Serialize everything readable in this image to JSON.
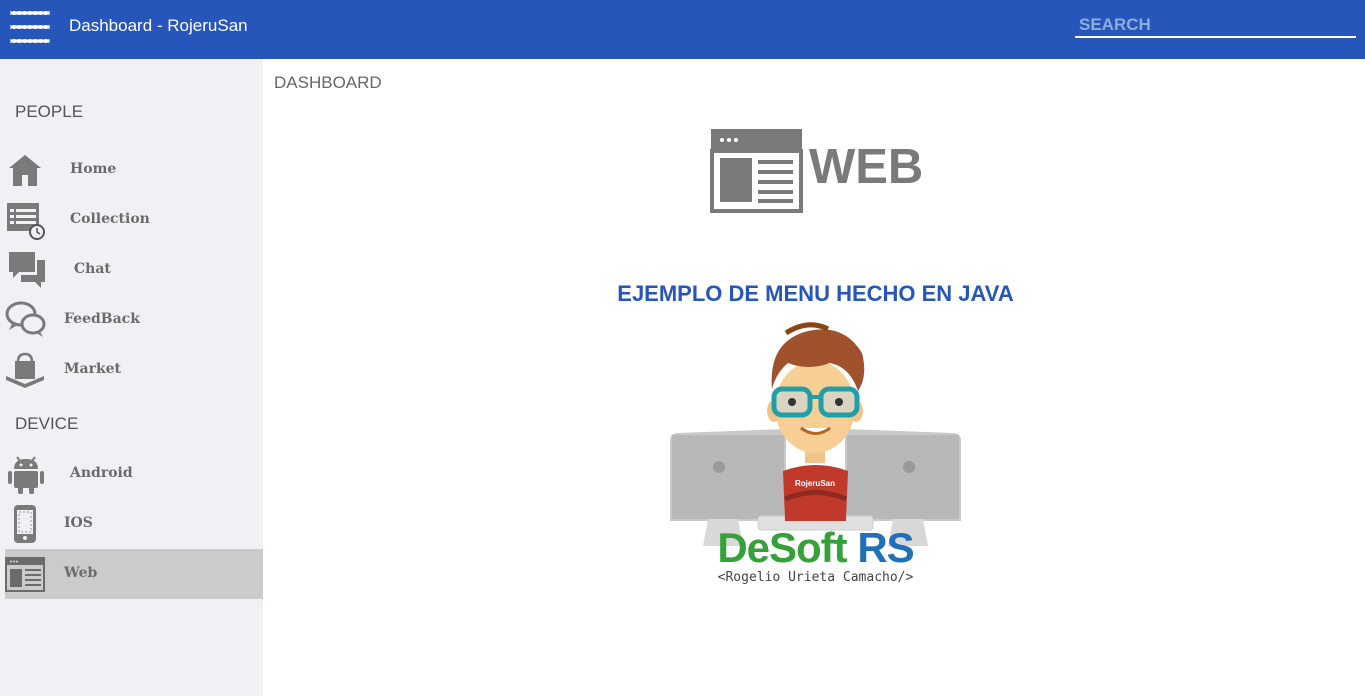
{
  "header": {
    "title": "Dashboard - RojeruSan",
    "search_placeholder": "SEARCH"
  },
  "sidebar": {
    "sections": [
      {
        "title": "PEOPLE"
      },
      {
        "title": "DEVICE"
      }
    ],
    "items": [
      {
        "label": "Home",
        "icon": "home-icon"
      },
      {
        "label": "Collection",
        "icon": "collection-icon"
      },
      {
        "label": "Chat",
        "icon": "chat-icon"
      },
      {
        "label": "FeedBack",
        "icon": "feedback-icon"
      },
      {
        "label": "Market",
        "icon": "market-icon"
      },
      {
        "label": "Android",
        "icon": "android-icon"
      },
      {
        "label": "IOS",
        "icon": "phone-icon"
      },
      {
        "label": "Web",
        "icon": "web-icon",
        "selected": true
      }
    ]
  },
  "main": {
    "breadcrumb": "DASHBOARD",
    "page_label": "WEB",
    "heading": "EJEMPLO DE MENU HECHO EN JAVA",
    "logo": {
      "badge": "RojeruSan",
      "brand_part1": "DeSoft",
      "brand_part2": "RS",
      "tagline": "<Rogelio Urieta Camacho/>"
    }
  },
  "colors": {
    "header_bg": "#2656b9",
    "sidebar_bg": "#f0f0f5",
    "selected_item_bg": "#cbcbcb",
    "heading": "#2656b9",
    "brand_green": "#34a139",
    "brand_blue": "#1f70b8"
  }
}
